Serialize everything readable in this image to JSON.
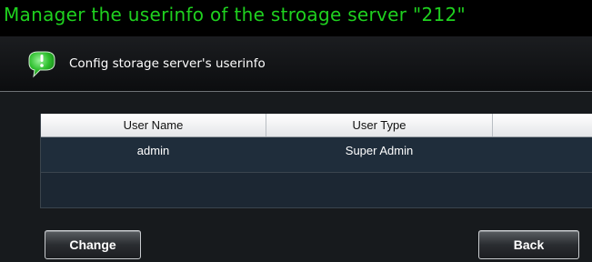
{
  "dialog": {
    "title": "Manager the userinfo of the stroage server \"212\"",
    "subtitle": "Config storage server's userinfo",
    "header_icon": "info-bubble-icon"
  },
  "table": {
    "columns": [
      "User Name",
      "User Type",
      ""
    ],
    "rows": [
      {
        "user_name": "admin",
        "user_type": "Super Admin"
      }
    ]
  },
  "buttons": {
    "change_label": "Change",
    "back_label": "Back"
  },
  "colors": {
    "title": "#1fd11f",
    "icon_green": "#2dbf2d",
    "background": "#000000"
  }
}
